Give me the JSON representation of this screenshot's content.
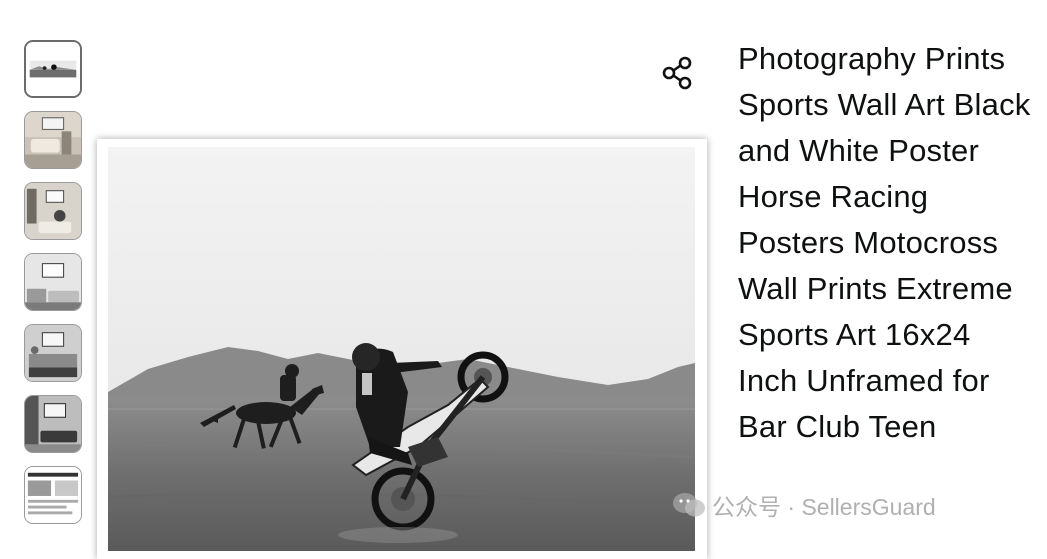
{
  "product": {
    "title": "Photography Prints Sports Wall Art Black and White Poster Horse Racing Posters Motocross Wall Prints Extreme Sports Art 16x24 Inch Unframed for Bar Club Teen"
  },
  "gallery": {
    "thumbnail_count": 7,
    "selected_index": 0
  },
  "icons": {
    "share": "share-icon",
    "watermark": "wechat-icon"
  },
  "watermark": {
    "text": "公众号 · SellersGuard"
  }
}
